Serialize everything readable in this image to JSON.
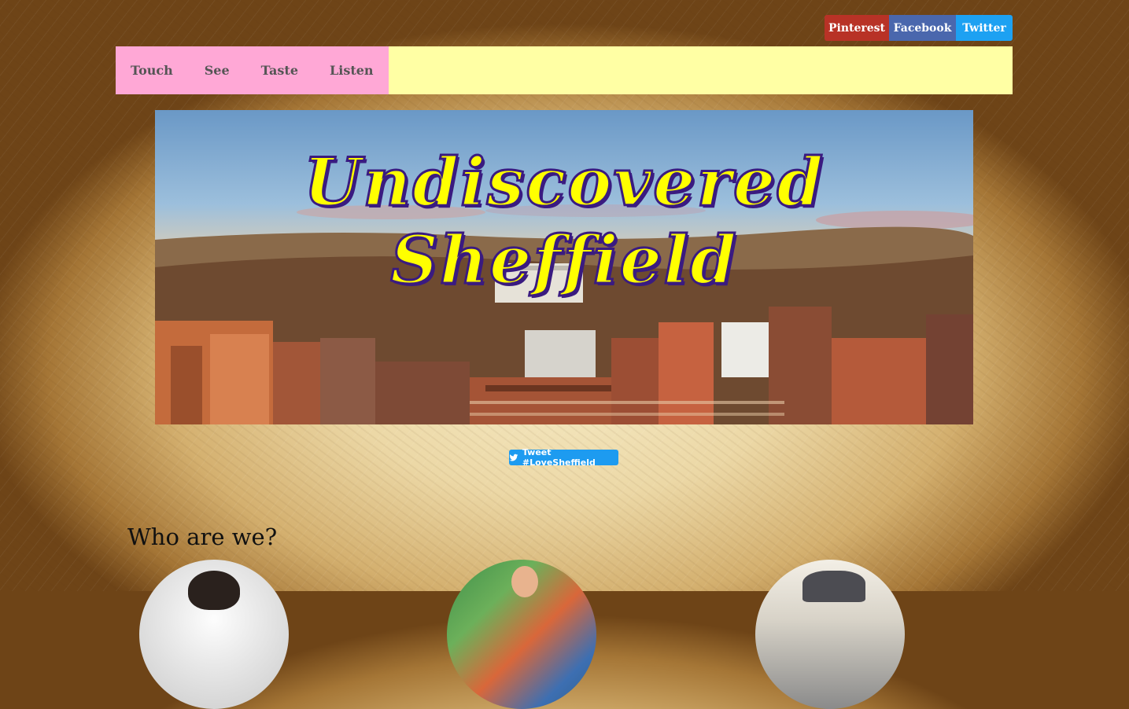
{
  "social": {
    "pinterest": "Pinterest",
    "facebook": "Facebook",
    "twitter": "Twitter"
  },
  "nav": {
    "items": [
      {
        "label": "Touch"
      },
      {
        "label": "See"
      },
      {
        "label": "Taste"
      },
      {
        "label": "Listen"
      }
    ]
  },
  "banner": {
    "title": "Undiscovered Sheffield"
  },
  "tweet_button": {
    "label": "Tweet #LoveSheffield",
    "icon": "twitter-bird-icon"
  },
  "about": {
    "heading": "Who are we?"
  },
  "colors": {
    "pinterest": "#b83226",
    "facebook": "#4a67ad",
    "twitter": "#1da1f2",
    "nav_bg": "#ffffa4",
    "nav_pink": "#ffa8d6",
    "banner_title": "#ffff00",
    "banner_title_outline": "#3a1b80"
  }
}
